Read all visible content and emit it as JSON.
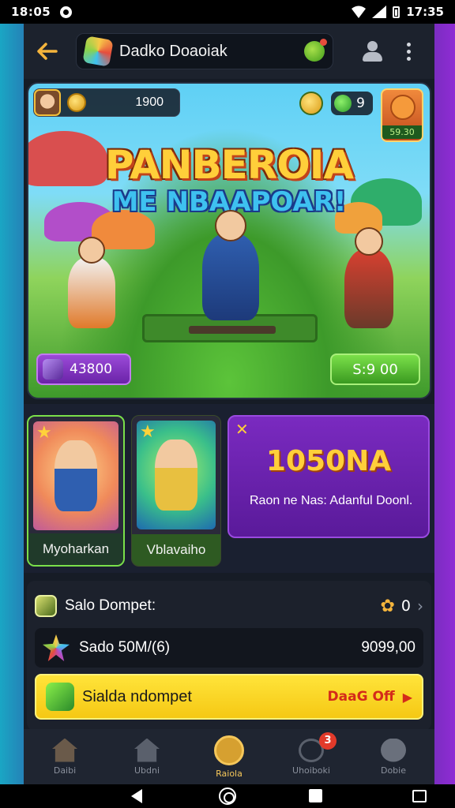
{
  "status_bar": {
    "time_left": "18:05",
    "time_right": "17:35"
  },
  "top_bar": {
    "title": "Dadko Doaoiak"
  },
  "hero": {
    "coins": "1900",
    "gems": "9",
    "shop_label": "59.30",
    "title_line1": "PANBEROIA",
    "title_line2": "ME NBAAPOAR!",
    "left_button": "43800",
    "right_button": "S:9 00"
  },
  "cards": [
    {
      "label": "Myoharkan"
    },
    {
      "label": "Vblavaiho"
    }
  ],
  "promo": {
    "headline": "1050NA",
    "description": "Raon ne Nas: Adanful Doonl."
  },
  "wallet": {
    "title": "Salo Dompet:",
    "count": "0",
    "balance_label": "Sado 50M/(6)",
    "balance_value": "9099,00",
    "action_label": "Sialda ndompet",
    "action_tag": "DaaG Off"
  },
  "bottom_nav": {
    "items": [
      {
        "label": "Daibi"
      },
      {
        "label": "Ubdni"
      },
      {
        "label": "Raiola"
      },
      {
        "label": "Uhoiboki"
      },
      {
        "label": "Dobie"
      }
    ],
    "badge": "3"
  },
  "colors": {
    "accent_gold": "#f5b53c",
    "promo_purple": "#7a2ac0",
    "action_yellow": "#ffe43a",
    "success_green": "#7be04a"
  }
}
